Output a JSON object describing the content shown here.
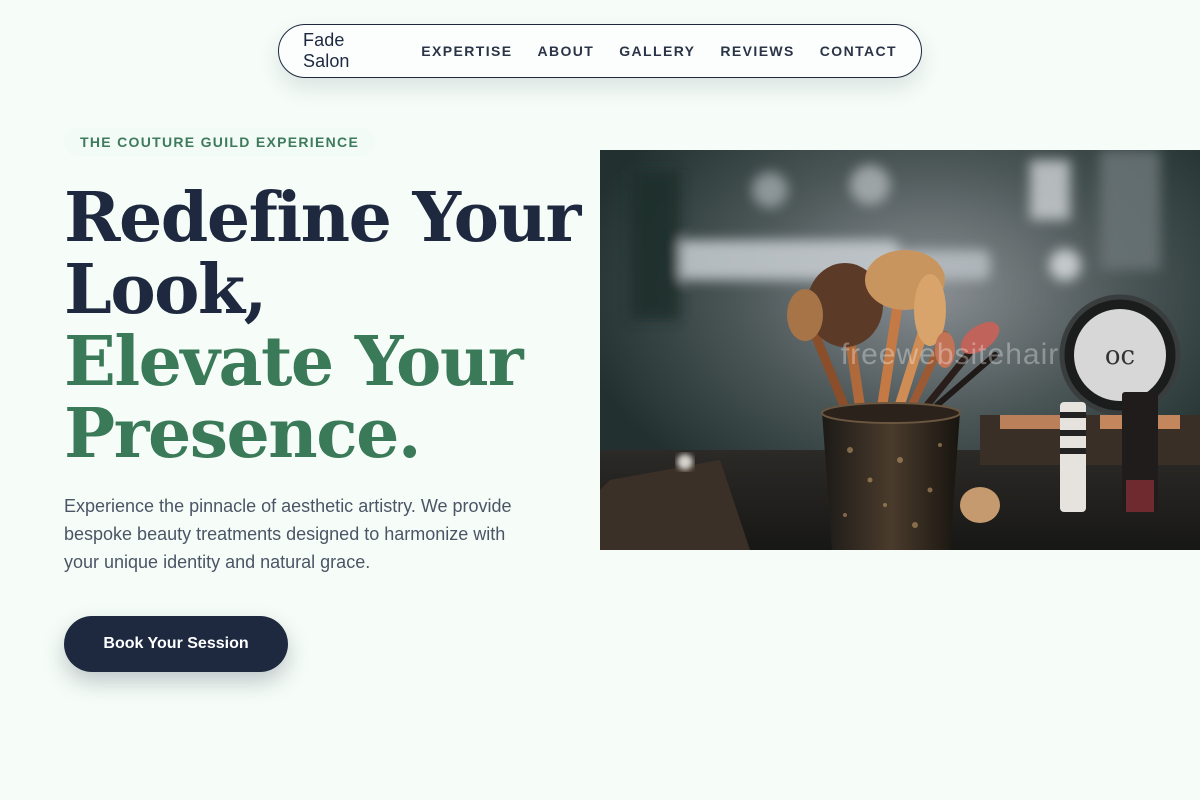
{
  "nav": {
    "brand": "Fade Salon",
    "links": [
      "EXPERTISE",
      "ABOUT",
      "GALLERY",
      "REVIEWS",
      "CONTACT"
    ]
  },
  "hero": {
    "eyebrow": "THE COUTURE GUILD EXPERIENCE",
    "headline_dark": [
      "Redefine Your",
      "Look,"
    ],
    "headline_accent": [
      "Elevate Your",
      "Presence."
    ],
    "lede": "Experience the pinnacle of aesthetic artistry. We provide bespoke beauty treatments designed to harmonize with your unique identity and natural grace.",
    "cta_label": "Book Your Session",
    "image_watermark": "freewebsitehair"
  },
  "colors": {
    "background": "#f6fdf8",
    "navy": "#1e2940",
    "accent_green": "#3a7a58"
  },
  "icons": {
    "hero_image": "makeup-brushes-photo"
  }
}
